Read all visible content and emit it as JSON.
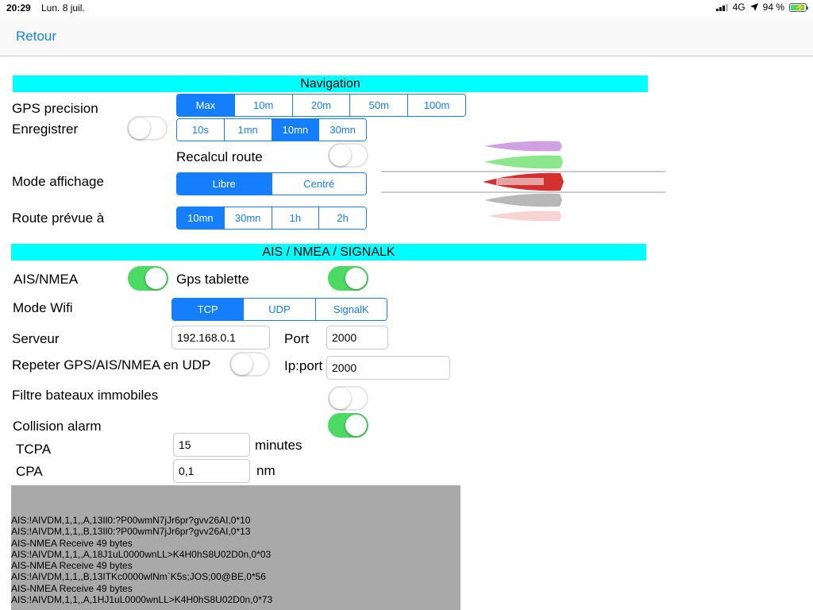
{
  "status_bar": {
    "time": "20:29",
    "date": "Lun. 8 juil.",
    "network": "4G",
    "battery_percent": "94 %",
    "battery_level": 0.94
  },
  "nav": {
    "back_label": "Retour"
  },
  "navigation_section": {
    "title": "Navigation",
    "gps_precision": {
      "label": "GPS precision",
      "options": [
        "Max",
        "10m",
        "20m",
        "50m",
        "100m"
      ],
      "selected": 0
    },
    "enregistrer": {
      "label": "Enregistrer",
      "toggle_on": false,
      "options": [
        "10s",
        "1mn",
        "10mn",
        "30mn"
      ],
      "selected": 2
    },
    "recalcul_route": {
      "label": "Recalcul route",
      "toggle_on": false
    },
    "mode_affichage": {
      "label": "Mode affichage",
      "options": [
        "Libre",
        "Centré"
      ],
      "selected": 0
    },
    "route_prevue": {
      "label": "Route prévue à",
      "options": [
        "10mn",
        "30mn",
        "1h",
        "2h"
      ],
      "selected": 0
    }
  },
  "ais_section": {
    "title": "AIS / NMEA / SIGNALK",
    "ais_nmea": {
      "label": "AIS/NMEA",
      "toggle_on": true
    },
    "gps_tablette": {
      "label": "Gps tablette",
      "toggle_on": true
    },
    "mode_wifi": {
      "label": "Mode Wifi",
      "options": [
        "TCP",
        "UDP",
        "SignalK"
      ],
      "selected": 0
    },
    "serveur": {
      "label": "Serveur",
      "value": "192.168.0.1"
    },
    "port": {
      "label": "Port",
      "value": "2000"
    },
    "repeter": {
      "label": "Repeter GPS/AIS/NMEA en UDP",
      "toggle_on": false
    },
    "ip_port": {
      "label": "Ip:port",
      "value": "2000"
    },
    "filtre": {
      "label": "Filtre bateaux immobiles",
      "toggle_on": false
    },
    "collision": {
      "label": "Collision alarm",
      "toggle_on": true
    },
    "tcpa": {
      "label": "TCPA",
      "value": "15",
      "unit": "minutes"
    },
    "cpa": {
      "label": "CPA",
      "value": "0,1",
      "unit": "nm"
    }
  },
  "log_lines": [
    "AIS:!AIVDM,1,1,,A,13Il0:?P00wmN7jJr6pr?gvv26AI,0*10",
    "AIS:!AIVDM,1,1,,B,13Il0:?P00wmN7jJr6pr?gvv26AI,0*13",
    "AIS-NMEA Receive 49 bytes",
    "AIS:!AIVDM,1,1,,A,18J1uL0000wnLL>K4H0hS8U02D0n,0*03",
    "AIS-NMEA Receive 49 bytes",
    "AIS:!AIVDM,1,1,,B,13ITKc0000wlNm`K5s;JOS;00@BE,0*56",
    "AIS-NMEA Receive 49 bytes",
    "AIS:!AIVDM,1,1,,A,1HJ1uL0000wnLL>K4H0hS8U02D0n,0*73"
  ],
  "colors": {
    "accent": "#147efb",
    "section_bar": "#00ffff",
    "toggle_on": "#4cd964",
    "log_bg": "#a9a9a9",
    "boat_purple": "#c080d8",
    "boat_green": "#66dd66",
    "boat_red": "#d43030",
    "boat_gray": "#a0a0a0"
  },
  "icons": [
    "signal-bars-icon",
    "location-arrow-icon",
    "battery-charging-icon",
    "boat-preview-image"
  ]
}
